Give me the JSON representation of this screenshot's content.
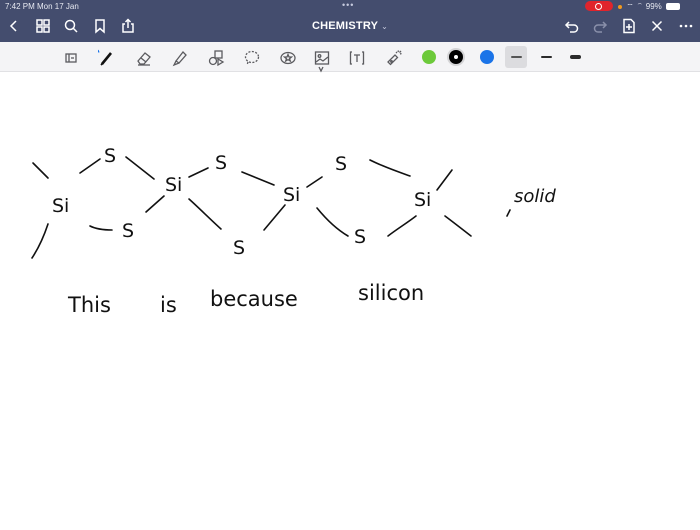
{
  "status_bar": {
    "time_date": "7:42 PM  Mon 17 Jan",
    "multitask_dots": "•••",
    "battery_text": "99%",
    "recording_indicator": "screen-recording"
  },
  "nav": {
    "title": "CHEMISTRY",
    "title_chevron": "⌄",
    "left_icons": [
      "back-icon",
      "grid-icon",
      "search-icon",
      "bookmark-icon",
      "share-icon"
    ],
    "right_icons": [
      "undo-icon",
      "redo-icon",
      "add-page-icon",
      "close-icon",
      "more-icon"
    ]
  },
  "toolbar": {
    "tools": [
      "read-only-mode",
      "pen",
      "eraser",
      "highlighter",
      "shapes",
      "lasso",
      "elements",
      "image",
      "text",
      "laser-pointer"
    ],
    "active_tool": "pen",
    "colors": [
      "#6cc93a",
      "#000000",
      "#1b74e8"
    ],
    "selected_color": "#000000",
    "stroke_widths": [
      "thin",
      "medium",
      "thick"
    ],
    "selected_stroke": "thin"
  },
  "canvas": {
    "handwriting": {
      "atoms": [
        "Si",
        "S",
        "Si",
        "S",
        "Si",
        "S",
        "S",
        "S",
        "Si",
        "S"
      ],
      "note": "solid",
      "sentence": [
        "This",
        "is",
        "because",
        "silicon"
      ]
    }
  }
}
